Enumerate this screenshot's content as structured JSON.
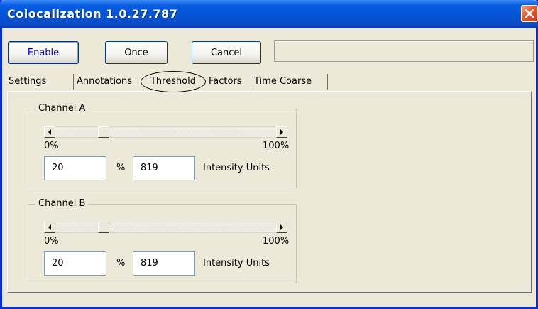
{
  "window": {
    "title": "Colocalization 1.0.27.787",
    "close_icon": "close-icon"
  },
  "toolbar": {
    "enable_label": "Enable",
    "once_label": "Once",
    "cancel_label": "Cancel",
    "status_text": ""
  },
  "tabs": [
    {
      "label": "Settings"
    },
    {
      "label": "Annotations"
    },
    {
      "label": "Threshold",
      "selected": true
    },
    {
      "label": "Factors"
    },
    {
      "label": "Time Coarse"
    }
  ],
  "channel_a": {
    "title": "Channel A",
    "slider_fraction": 0.2,
    "min_label": "0%",
    "max_label": "100%",
    "percent_value": "20",
    "percent_sign": "%",
    "intensity_value": "819",
    "units_label": "Intensity Units"
  },
  "channel_b": {
    "title": "Channel B",
    "slider_fraction": 0.2,
    "min_label": "0%",
    "max_label": "100%",
    "percent_value": "20",
    "percent_sign": "%",
    "intensity_value": "819",
    "units_label": "Intensity Units"
  },
  "colors": {
    "titlebar": "#0454d8",
    "window_face": "#ece9d8",
    "enable_text": "#0000cc",
    "close_button": "#e25a2e"
  }
}
